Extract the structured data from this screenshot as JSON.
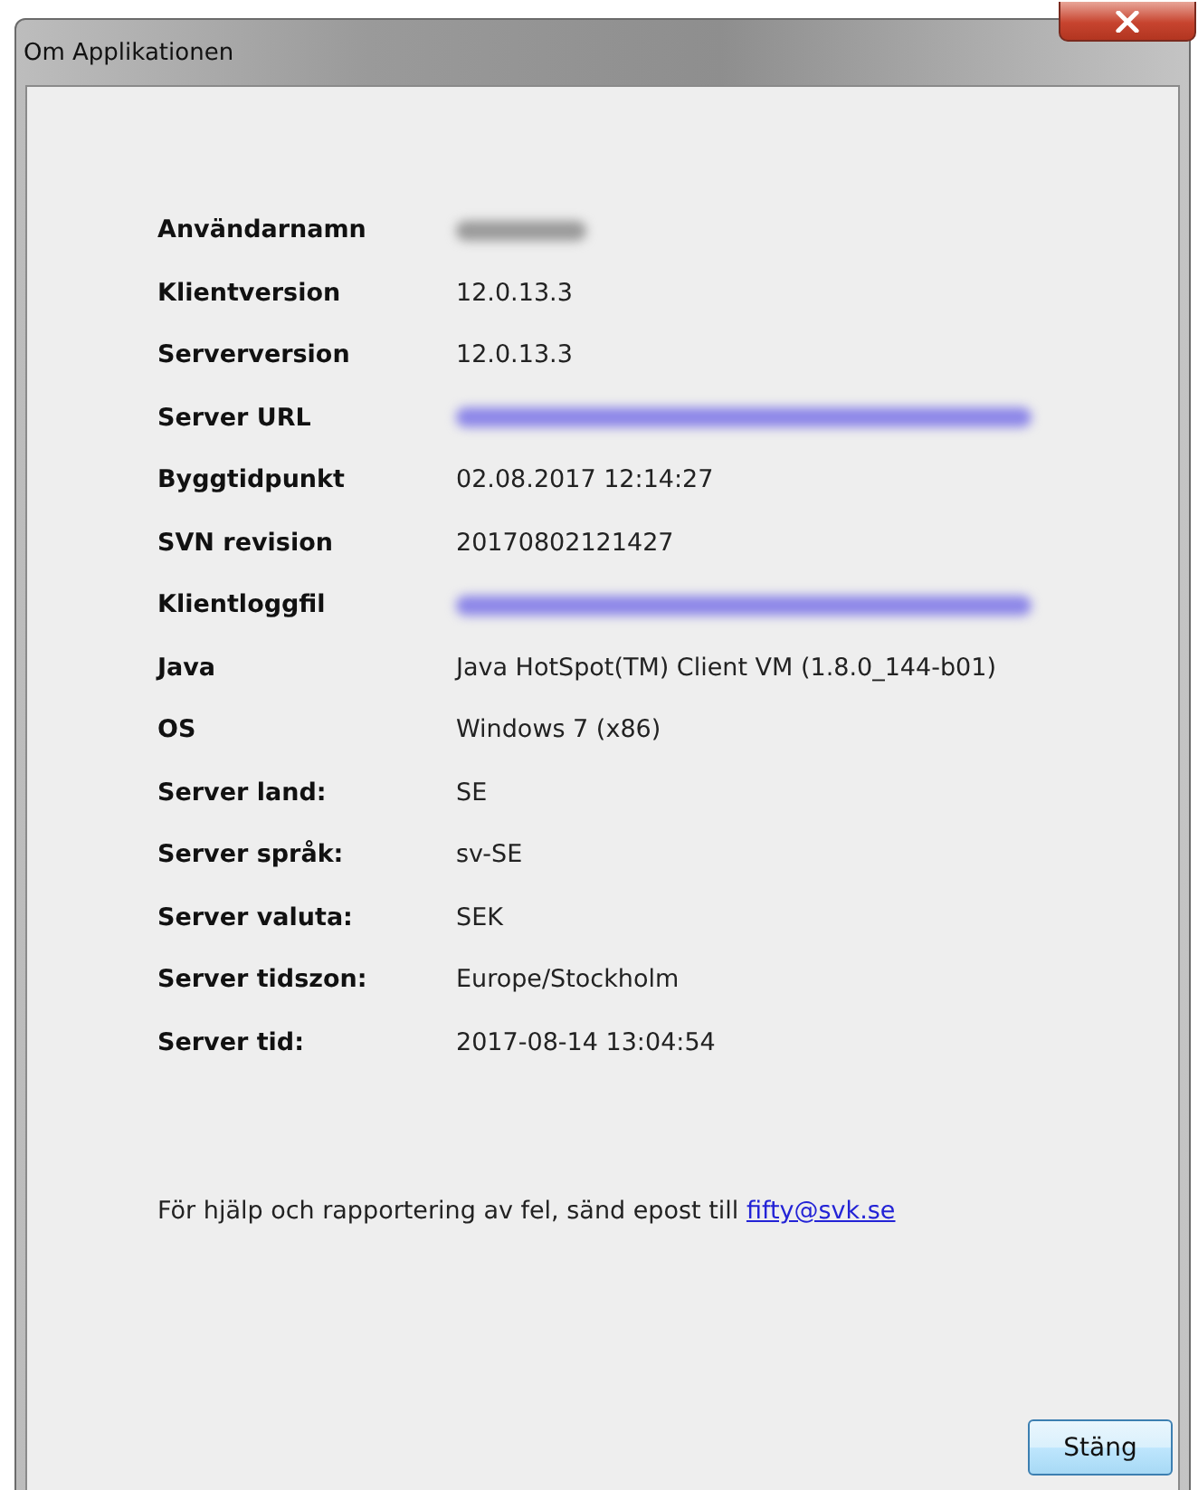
{
  "window": {
    "title": "Om Applikationen"
  },
  "fields": [
    {
      "label": "Användarnamn",
      "kind": "blurred"
    },
    {
      "label": "Klientversion",
      "kind": "text",
      "value": "12.0.13.3"
    },
    {
      "label": "Serverversion",
      "kind": "text",
      "value": "12.0.13.3"
    },
    {
      "label": "Server URL",
      "kind": "blurred-link"
    },
    {
      "label": "Byggtidpunkt",
      "kind": "text",
      "value": "02.08.2017 12:14:27"
    },
    {
      "label": "SVN revision",
      "kind": "text",
      "value": "20170802121427"
    },
    {
      "label": "Klientloggfil",
      "kind": "blurred-link"
    },
    {
      "label": "Java",
      "kind": "text",
      "value": "Java HotSpot(TM) Client VM (1.8.0_144-b01)"
    },
    {
      "label": "OS",
      "kind": "text",
      "value": "Windows 7 (x86)"
    },
    {
      "label": "Server land:",
      "kind": "text",
      "value": "SE"
    },
    {
      "label": "Server språk:",
      "kind": "text",
      "value": "sv-SE"
    },
    {
      "label": "Server valuta:",
      "kind": "text",
      "value": "SEK"
    },
    {
      "label": "Server tidszon:",
      "kind": "text",
      "value": "Europe/Stockholm"
    },
    {
      "label": "Server tid:",
      "kind": "text",
      "value": "2017-08-14 13:04:54"
    }
  ],
  "help": {
    "text": "För hjälp och rapportering av fel, sänd epost till",
    "link": "fifty@svk.se"
  },
  "buttons": [
    "Stäng"
  ]
}
